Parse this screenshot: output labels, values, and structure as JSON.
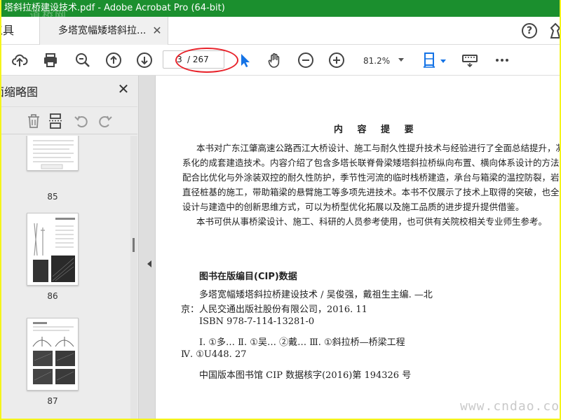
{
  "window": {
    "title": "塔斜拉桥建设技术.pdf - Adobe Acrobat Pro (64-bit)",
    "watermark": "道桥网"
  },
  "tabs": {
    "tools_label": "工具",
    "doc_tab_label": "多塔宽幅矮塔斜拉..."
  },
  "toolbar": {
    "page_current": "3",
    "page_total": "/ 267",
    "zoom": "81.2%",
    "annotation_color": "#e8222a",
    "accent_color": "#1473e6"
  },
  "sidebar": {
    "title": "页面缩略图",
    "thumbnails": [
      {
        "label": "85"
      },
      {
        "label": "86"
      },
      {
        "label": "87"
      }
    ]
  },
  "document": {
    "heading": "内 容 提 要",
    "abstract_lines": [
      "本书对广东江肇高速公路西江大桥设计、施工与耐久性提升技术与经验进行了全面总结提升，凝练成体",
      "系化的成套建造技术。内容介绍了包含多塔长联脊骨梁矮塔斜拉桥纵向布置、横向体系设计的方法，混凝土",
      "配合比优化与外涂装双控的耐久性防护，季节性河流的临时栈桥建造，承台与箱梁的温控防裂，岩溶地区大",
      "直径桩基的施工，带助箱梁的悬臂施工等多项先进技术。本书不仅展示了技术上取得的突破，也全面体现了",
      "设计与建造中的创新思维方式，可以为桥型优化拓展以及施工品质的进步提升提供借鉴。",
      "本书可供从事桥梁设计、施工、科研的人员参考使用，也可供有关院校相关专业师生参考。"
    ],
    "cip_heading": "图书在版编目(CIP)数据",
    "cip_lines": [
      "多塔宽幅矮塔斜拉桥建设技术 / 吴俊强，戴祖生主编. —北",
      "京：人民交通出版社股份有限公司，2016. 11",
      "ISBN  978-7-114-13281-0",
      "Ⅰ. ①多…   Ⅱ. ①吴… ②戴…   Ⅲ. ①斜拉桥—桥梁工程",
      "Ⅳ. ①U448. 27",
      "中国版本图书馆 CIP 数据核字(2016)第 194326 号"
    ]
  },
  "footer": {
    "watermark": "www.cndao.com"
  }
}
